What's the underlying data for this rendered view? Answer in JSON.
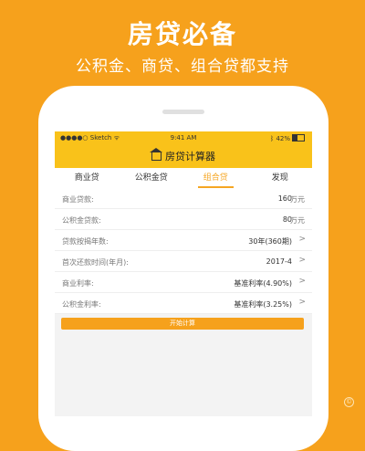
{
  "promo": {
    "title": "房贷必备",
    "subtitle": "公积金、商贷、组合贷都支持"
  },
  "status_bar": {
    "carrier": "●●●●○ Sketch ᯤ",
    "time": "9:41 AM",
    "battery": "ᛒ 42%"
  },
  "nav": {
    "title": "房贷计算器",
    "icon": "home-icon"
  },
  "tabs": [
    {
      "label": "商业贷",
      "active": false
    },
    {
      "label": "公积金贷",
      "active": false
    },
    {
      "label": "组合贷",
      "active": true
    },
    {
      "label": "发现",
      "active": false
    }
  ],
  "form": {
    "commercial_amount": {
      "label": "商业贷款:",
      "value": "160",
      "unit": "万元"
    },
    "fund_amount": {
      "label": "公积金贷款:",
      "value": "80",
      "unit": "万元"
    },
    "term": {
      "label": "贷款按揭年数:",
      "value": "30年(360期)"
    },
    "first_payment": {
      "label": "首次还款时间(年月):",
      "value": "2017-4"
    },
    "commercial_rate": {
      "label": "商业利率:",
      "value": "基准利率(4.90%)"
    },
    "fund_rate": {
      "label": "公积金利率:",
      "value": "基准利率(3.25%)"
    }
  },
  "start_button_label": "开始计算",
  "colors": {
    "background": "#f6a11c",
    "status_bar": "#f9c21a",
    "accent": "#f5a623"
  }
}
